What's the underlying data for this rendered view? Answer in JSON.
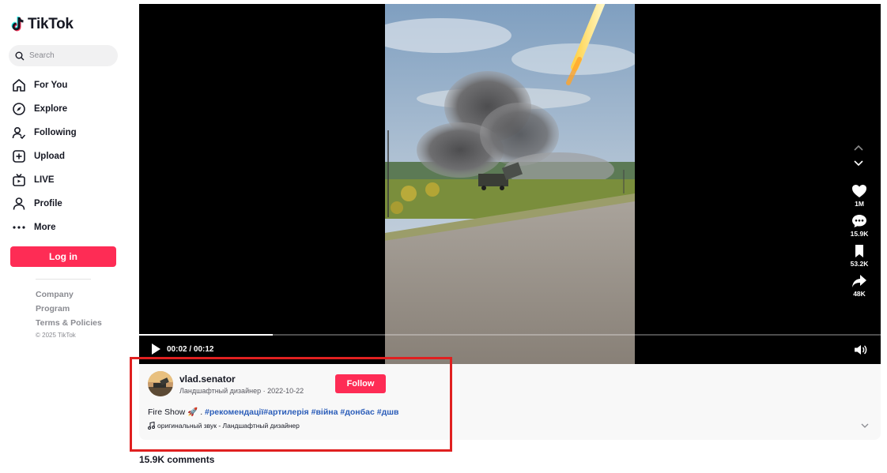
{
  "app": {
    "name": "TikTok"
  },
  "search": {
    "placeholder": "Search"
  },
  "nav": [
    {
      "label": "For You",
      "icon": "home-icon"
    },
    {
      "label": "Explore",
      "icon": "compass-icon"
    },
    {
      "label": "Following",
      "icon": "following-icon"
    },
    {
      "label": "Upload",
      "icon": "upload-icon"
    },
    {
      "label": "LIVE",
      "icon": "live-icon"
    },
    {
      "label": "Profile",
      "icon": "profile-icon"
    },
    {
      "label": "More",
      "icon": "more-icon"
    }
  ],
  "login": {
    "label": "Log in"
  },
  "footer": {
    "links": [
      "Company",
      "Program",
      "Terms & Policies"
    ],
    "copyright": "© 2025 TikTok"
  },
  "video": {
    "time": "00:02 / 00:12",
    "progress": 0.18
  },
  "actions": {
    "likes": "1M",
    "comments": "15.9K",
    "saves": "53.2K",
    "shares": "48K"
  },
  "author": {
    "username": "vlad.senator",
    "nickname": "Ландшафтный дизайнер",
    "date": "2022-10-22"
  },
  "follow": {
    "label": "Follow"
  },
  "description": {
    "text": "Fire Show",
    "emoji": "🚀",
    "sep": " . ",
    "hashtags": [
      "#рекомендації",
      "#артилерія",
      "#війна",
      "#донбас",
      "#дшв"
    ]
  },
  "sound": {
    "text": "оригинальный звук - Ландшафтный дизайнер"
  },
  "comments": {
    "count_label": "15.9K comments"
  },
  "colors": {
    "brand": "#fe2c55",
    "hashtag": "#2b5db9",
    "highlight": "#e02020"
  }
}
